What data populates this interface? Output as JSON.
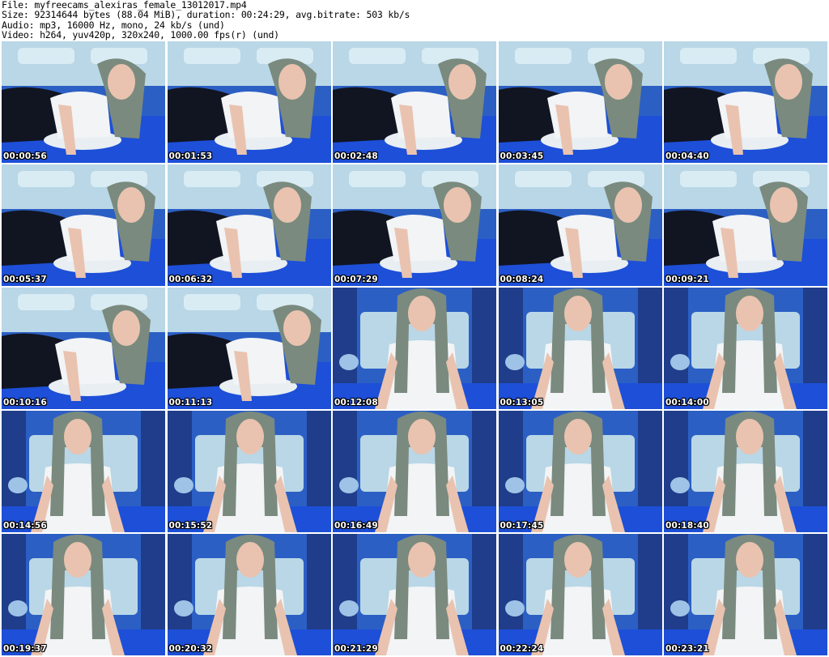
{
  "header": {
    "file": "File: myfreecams_alexiras_female_13012017.mp4",
    "size": "Size: 92314644 bytes (88.04 MiB), duration: 00:24:29, avg.bitrate: 503 kb/s",
    "audio": "Audio: mp3, 16000 Hz, mono, 24 kb/s (und)",
    "video": "Video: h264, yuv420p, 320x240, 1000.00 fps(r) (und)"
  },
  "thumbnails": [
    {
      "time": "00:00:56",
      "scene": "reclining"
    },
    {
      "time": "00:01:53",
      "scene": "reclining"
    },
    {
      "time": "00:02:48",
      "scene": "reclining"
    },
    {
      "time": "00:03:45",
      "scene": "reclining"
    },
    {
      "time": "00:04:40",
      "scene": "reclining"
    },
    {
      "time": "00:05:37",
      "scene": "reclining"
    },
    {
      "time": "00:06:32",
      "scene": "reclining"
    },
    {
      "time": "00:07:29",
      "scene": "reclining"
    },
    {
      "time": "00:08:24",
      "scene": "reclining"
    },
    {
      "time": "00:09:21",
      "scene": "reclining"
    },
    {
      "time": "00:10:16",
      "scene": "reclining"
    },
    {
      "time": "00:11:13",
      "scene": "reclining"
    },
    {
      "time": "00:12:08",
      "scene": "sitting"
    },
    {
      "time": "00:13:05",
      "scene": "sitting"
    },
    {
      "time": "00:14:00",
      "scene": "sitting"
    },
    {
      "time": "00:14:56",
      "scene": "sitting"
    },
    {
      "time": "00:15:52",
      "scene": "sitting"
    },
    {
      "time": "00:16:49",
      "scene": "sitting"
    },
    {
      "time": "00:17:45",
      "scene": "sitting"
    },
    {
      "time": "00:18:40",
      "scene": "sitting"
    },
    {
      "time": "00:19:37",
      "scene": "sitting"
    },
    {
      "time": "00:20:32",
      "scene": "sitting"
    },
    {
      "time": "00:21:29",
      "scene": "sitting"
    },
    {
      "time": "00:22:24",
      "scene": "sitting"
    },
    {
      "time": "00:23:21",
      "scene": "sitting"
    }
  ],
  "colors": {
    "background": "#ffffff",
    "text": "#000000",
    "timestamp": "#ffffff",
    "bed": "#1d4fd8",
    "wall": "#2b5fc4",
    "headboard": "#b9d7e6",
    "shirt": "#f2f4f6",
    "hair": "#7a8a7e",
    "skin": "#e9c3b0",
    "dark": "#111522"
  }
}
